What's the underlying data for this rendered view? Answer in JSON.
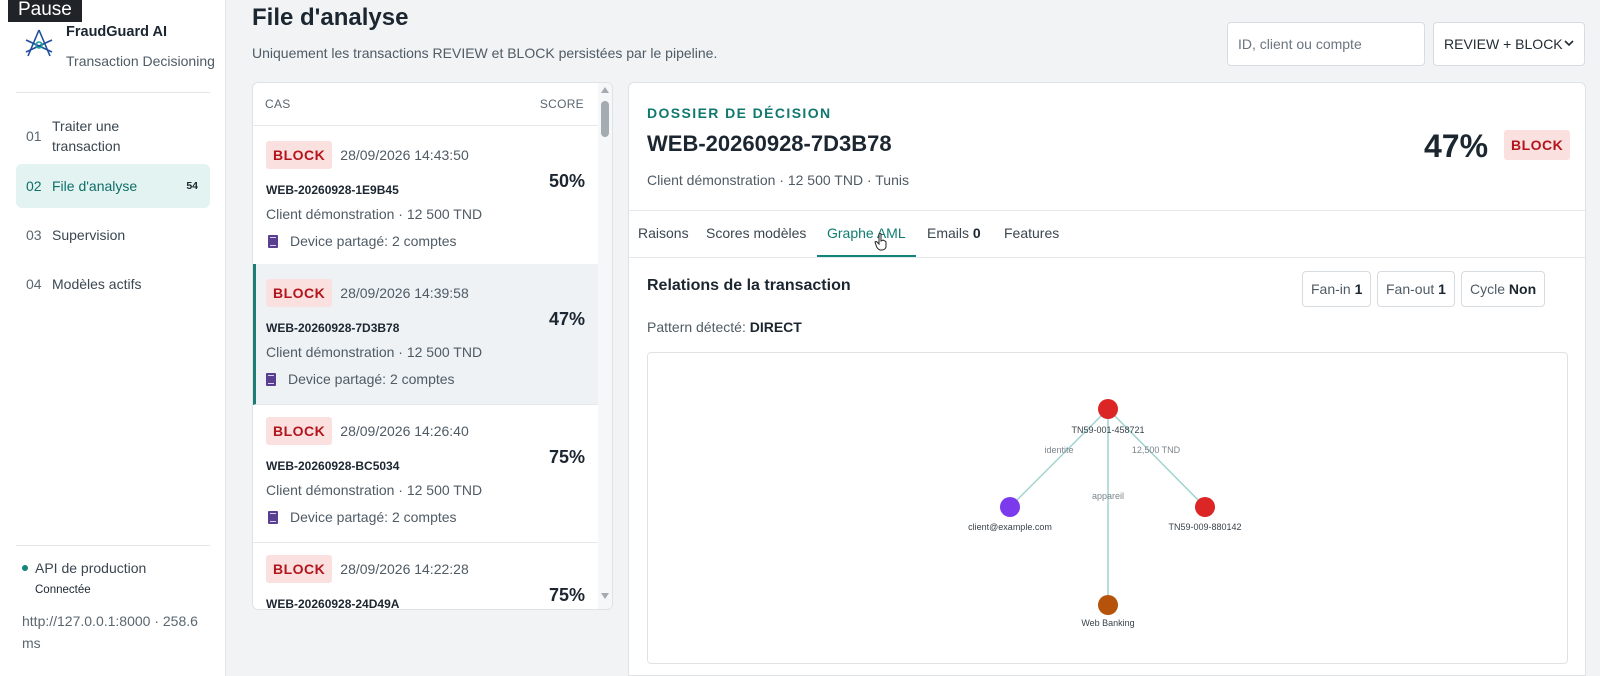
{
  "overlay": {
    "pause_label": "Pause"
  },
  "brand": {
    "name": "FraudGuard AI",
    "subtitle": "Transaction Decisioning"
  },
  "nav": [
    {
      "num": "01",
      "label": "Traiter une transaction",
      "badge": ""
    },
    {
      "num": "02",
      "label": "File d'analyse",
      "badge": "54"
    },
    {
      "num": "03",
      "label": "Supervision",
      "badge": ""
    },
    {
      "num": "04",
      "label": "Modèles actifs",
      "badge": ""
    }
  ],
  "api": {
    "title": "API de production",
    "status": "Connectée",
    "url": "http://127.0.0.1:8000 · 258.6 ms"
  },
  "header": {
    "title": "File d'analyse",
    "subtitle": "Uniquement les transactions REVIEW et BLOCK persistées par le pipeline.",
    "search_placeholder": "ID, client ou compte",
    "filter_value": "REVIEW + BLOCK"
  },
  "list": {
    "col_case": "CAS",
    "col_score": "SCORE",
    "cases": [
      {
        "decision": "BLOCK",
        "date": "28/09/2026 14:43:50",
        "id": "WEB-20260928-1E9B45",
        "client": "Client démonstration · 12 500 TND",
        "flag": "Device partagé: 2 comptes",
        "score": "50%"
      },
      {
        "decision": "BLOCK",
        "date": "28/09/2026 14:39:58",
        "id": "WEB-20260928-7D3B78",
        "client": "Client démonstration · 12 500 TND",
        "flag": "Device partagé: 2 comptes",
        "score": "47%"
      },
      {
        "decision": "BLOCK",
        "date": "28/09/2026 14:26:40",
        "id": "WEB-20260928-BC5034",
        "client": "Client démonstration · 12 500 TND",
        "flag": "Device partagé: 2 comptes",
        "score": "75%"
      },
      {
        "decision": "BLOCK",
        "date": "28/09/2026 14:22:28",
        "id": "WEB-20260928-24D49A",
        "client": "",
        "flag": "",
        "score": "75%"
      }
    ]
  },
  "detail": {
    "label": "DOSSIER DE DÉCISION",
    "id": "WEB-20260928-7D3B78",
    "meta": "Client démonstration · 12 500 TND · Tunis",
    "score": "47%",
    "decision": "BLOCK",
    "tabs": [
      {
        "label": "Raisons",
        "count": ""
      },
      {
        "label": "Scores modèles",
        "count": ""
      },
      {
        "label": "Graphe AML",
        "count": ""
      },
      {
        "label": "Emails",
        "count": "0"
      },
      {
        "label": "Features",
        "count": ""
      }
    ],
    "relations_title": "Relations de la transaction",
    "pattern_label": "Pattern détecté:",
    "pattern_value": "DIRECT",
    "stats": [
      {
        "label": "Fan-in",
        "value": "1"
      },
      {
        "label": "Fan-out",
        "value": "1"
      },
      {
        "label": "Cycle",
        "value": "Non"
      }
    ]
  },
  "graph": {
    "nodes": [
      {
        "label": "TN59-001-458721",
        "color": "#dc2626"
      },
      {
        "label": "client@example.com",
        "color": "#7c3aed"
      },
      {
        "label": "TN59-009-880142",
        "color": "#dc2626"
      },
      {
        "label": "Web Banking",
        "color": "#b45309"
      }
    ],
    "edges": [
      {
        "label": "identite"
      },
      {
        "label": "12,500 TND"
      },
      {
        "label": "appareil"
      }
    ]
  },
  "colors": {
    "accent": "#12857a",
    "block_bg": "#fbe0e0",
    "block_text": "#b3151d"
  }
}
